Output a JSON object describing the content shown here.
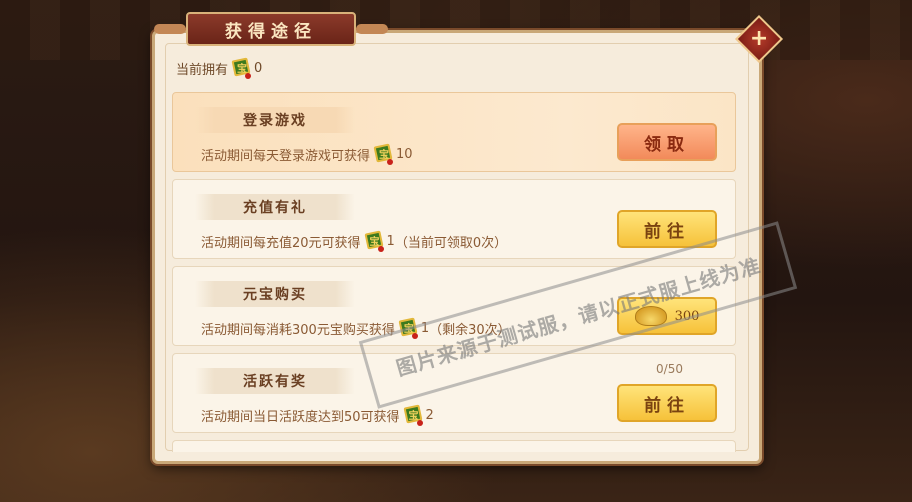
{
  "dialog": {
    "title": "获得途径",
    "close_label": "+"
  },
  "owned": {
    "label": "当前拥有",
    "icon": "green-token-icon",
    "value": "0"
  },
  "rows": [
    {
      "title": "登录游戏",
      "desc_prefix": "活动期间每天登录游戏可获得",
      "amount": "10",
      "desc_suffix": "",
      "button": "领取",
      "button_type": "claim",
      "highlighted": true
    },
    {
      "title": "充值有礼",
      "desc_prefix": "活动期间每充值20元可获得",
      "amount": "1",
      "desc_suffix": "（当前可领取0次）",
      "button": "前往",
      "button_type": "go"
    },
    {
      "title": "元宝购买",
      "desc_prefix": "活动期间每消耗300元宝购买获得",
      "amount": "1",
      "desc_suffix": "（剩余30次）",
      "button": "300",
      "button_type": "ingot"
    },
    {
      "title": "活跃有奖",
      "desc_prefix": "活动期间当日活跃度达到50可获得",
      "amount": "2",
      "desc_suffix": "",
      "button": "前往",
      "button_type": "go",
      "progress": "0/50"
    }
  ],
  "watermark": "图片来源于测试服，请以正式服上线为准",
  "colors": {
    "panel_bg": "#f6ecdc",
    "claim_button": "#f28a5a",
    "go_button": "#f6c23a",
    "title_tab": "#8b3a2a"
  }
}
